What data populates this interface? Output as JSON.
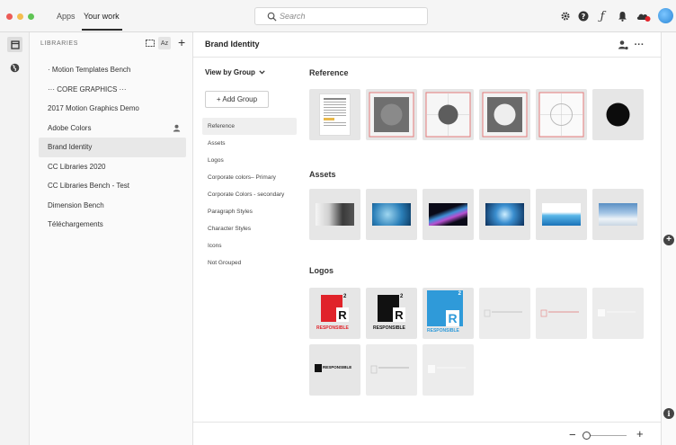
{
  "topbar": {
    "tabs": [
      {
        "label": "Apps"
      },
      {
        "label": "Your work"
      }
    ],
    "search_placeholder": "Search",
    "icons": [
      "settings-icon",
      "help-icon",
      "fonts-icon",
      "notifications-icon",
      "cloud-icon"
    ]
  },
  "libraries": {
    "heading": "LIBRARIES",
    "sort_label": "Az",
    "items": [
      {
        "label": "· Motion Templates Bench"
      },
      {
        "label": "··· CORE GRAPHICS ···"
      },
      {
        "label": "2017 Motion Graphics Demo"
      },
      {
        "label": "Adobe Colors"
      },
      {
        "label": "Brand Identity"
      },
      {
        "label": "CC Libraries 2020"
      },
      {
        "label": "CC Libraries Bench - Test"
      },
      {
        "label": "Dimension Bench"
      },
      {
        "label": "Téléchargements"
      }
    ],
    "active_index": 4
  },
  "main": {
    "title": "Brand Identity",
    "view_by": "View by Group",
    "add_group": "+ Add Group",
    "groups": [
      {
        "label": "Reference"
      },
      {
        "label": "Assets"
      },
      {
        "label": "Logos"
      },
      {
        "label": "Corporate colors– Primary"
      },
      {
        "label": "Corporate Colors - secondary"
      },
      {
        "label": "Paragraph Styles"
      },
      {
        "label": "Character Styles"
      },
      {
        "label": "Icons"
      },
      {
        "label": "Not Grouped"
      }
    ],
    "sections": {
      "reference": {
        "title": "Reference"
      },
      "assets": {
        "title": "Assets"
      },
      "logos": {
        "title": "Logos",
        "logo_word": "RESPONSIBLE",
        "logo_letter": "R",
        "logo_sup": "2"
      }
    }
  },
  "colors": {
    "logo_red": "#e0232a",
    "logo_black": "#111111",
    "logo_blue": "#2f9ad9"
  }
}
